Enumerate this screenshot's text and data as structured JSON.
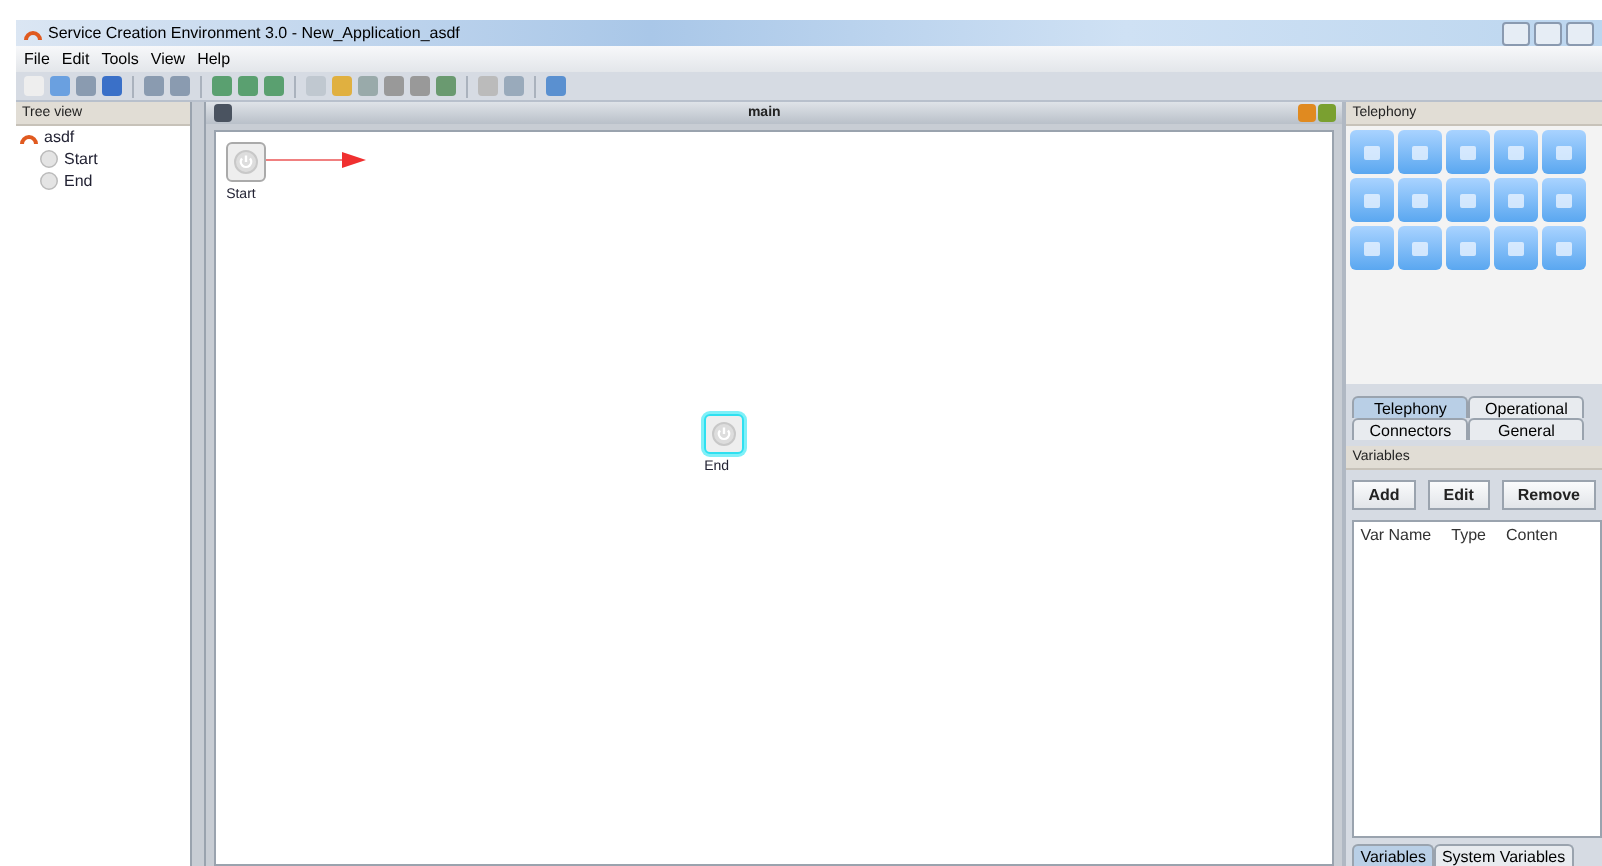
{
  "window": {
    "title": "Service Creation Environment 3.0 - New_Application_asdf"
  },
  "menu": [
    "File",
    "Edit",
    "Tools",
    "View",
    "Help"
  ],
  "tree_view": {
    "title": "Tree view",
    "root": {
      "label": "asdf",
      "children": [
        {
          "label": "Start"
        },
        {
          "label": "End"
        }
      ]
    }
  },
  "editor": {
    "title": "main",
    "nodes": [
      {
        "label": "Start",
        "kind": "start",
        "selected": false
      },
      {
        "label": "End",
        "kind": "end",
        "selected": true
      }
    ]
  },
  "palette": {
    "title": "Telephony",
    "tabs_row_1": [
      {
        "label": "Telephony",
        "selected": true
      },
      {
        "label": "Operational",
        "selected": false
      }
    ],
    "tabs_row_2": [
      {
        "label": "Connectors",
        "selected": false
      },
      {
        "label": "General",
        "selected": false
      }
    ]
  },
  "variables": {
    "title": "Variables",
    "buttons": [
      "Add",
      "Edit",
      "Remove"
    ],
    "columns": [
      "Var Name",
      "Type",
      "Conten"
    ],
    "tabs": [
      {
        "label": "Variables",
        "selected": true
      },
      {
        "label": "System Variables",
        "selected": false
      }
    ]
  }
}
